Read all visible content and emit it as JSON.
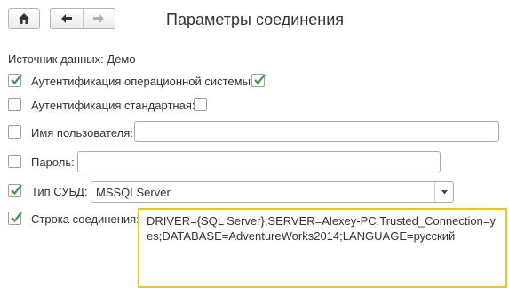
{
  "toolbar": {
    "home_icon": "home-icon",
    "back_icon": "arrow-left-icon",
    "forward_icon": "arrow-right-icon"
  },
  "title": "Параметры соединения",
  "data_source": {
    "label": "Источник данных:",
    "value": "Демо"
  },
  "os_auth": {
    "label": "Аутентификация операционной системы:",
    "checked": true,
    "value_checked": true
  },
  "std_auth": {
    "label": "Аутентификация стандартная:",
    "checked": false,
    "value_checked": false
  },
  "username": {
    "label": "Имя пользователя:",
    "checked": false,
    "value": ""
  },
  "password": {
    "label": "Пароль:",
    "checked": false,
    "value": ""
  },
  "dbms_type": {
    "label": "Тип СУБД:",
    "checked": true,
    "value": "MSSQLServer"
  },
  "connection_string": {
    "label": "Строка соединения:",
    "checked": true,
    "value": "DRIVER={SQL Server};SERVER=Alexey-PC;Trusted_Connection=yes;DATABASE=AdventureWorks2014;LANGUAGE=русский"
  },
  "colors": {
    "check_green": "#3a9a3a",
    "focus_border": "#f2c313"
  }
}
